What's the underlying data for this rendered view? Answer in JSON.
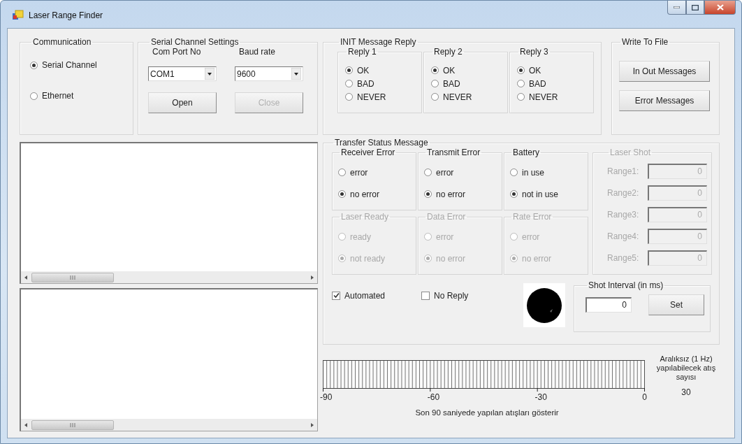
{
  "window": {
    "title": "Laser Range Finder"
  },
  "communication": {
    "title": "Communication",
    "options": [
      {
        "label": "Serial Channel",
        "selected": true
      },
      {
        "label": "Ethernet",
        "selected": false
      }
    ]
  },
  "serial_settings": {
    "title": "Serial Channel Settings",
    "com_port": {
      "label": "Com Port No",
      "value": "COM1"
    },
    "baud_rate": {
      "label": "Baud rate",
      "value": "9600"
    },
    "buttons": [
      {
        "label": "Open",
        "disabled": false
      },
      {
        "label": "Close",
        "disabled": true
      }
    ]
  },
  "init_reply": {
    "title": "INIT Message Reply",
    "groups": [
      {
        "title": "Reply 1",
        "options": [
          {
            "label": "OK",
            "selected": true
          },
          {
            "label": "BAD",
            "selected": false
          },
          {
            "label": "NEVER",
            "selected": false
          }
        ]
      },
      {
        "title": "Reply 2",
        "options": [
          {
            "label": "OK",
            "selected": true
          },
          {
            "label": "BAD",
            "selected": false
          },
          {
            "label": "NEVER",
            "selected": false
          }
        ]
      },
      {
        "title": "Reply 3",
        "options": [
          {
            "label": "OK",
            "selected": true
          },
          {
            "label": "BAD",
            "selected": false
          },
          {
            "label": "NEVER",
            "selected": false
          }
        ]
      }
    ]
  },
  "write_to_file": {
    "title": "Write To File",
    "buttons": [
      "In Out Messages",
      "Error Messages"
    ]
  },
  "transfer_status": {
    "title": "Transfer Status Message",
    "groups": [
      {
        "title": "Receiver Error",
        "disabled": false,
        "options": [
          {
            "label": "error",
            "selected": false
          },
          {
            "label": "no error",
            "selected": true
          }
        ]
      },
      {
        "title": "Transmit Error",
        "disabled": false,
        "options": [
          {
            "label": "error",
            "selected": false
          },
          {
            "label": "no error",
            "selected": true
          }
        ]
      },
      {
        "title": "Battery",
        "disabled": false,
        "options": [
          {
            "label": "in use",
            "selected": false
          },
          {
            "label": "not in use",
            "selected": true
          }
        ]
      },
      {
        "title": "Laser Ready",
        "disabled": true,
        "options": [
          {
            "label": "ready",
            "selected": false
          },
          {
            "label": "not ready",
            "selected": true
          }
        ]
      },
      {
        "title": "Data Error",
        "disabled": true,
        "options": [
          {
            "label": "error",
            "selected": false
          },
          {
            "label": "no error",
            "selected": true
          }
        ]
      },
      {
        "title": "Rate Error",
        "disabled": true,
        "options": [
          {
            "label": "error",
            "selected": false
          },
          {
            "label": "no error",
            "selected": true
          }
        ]
      }
    ],
    "laser_shot": {
      "title": "Laser Shot",
      "disabled": true,
      "ranges": [
        {
          "label": "Range1:",
          "value": "0"
        },
        {
          "label": "Range2:",
          "value": "0"
        },
        {
          "label": "Range3:",
          "value": "0"
        },
        {
          "label": "Range4:",
          "value": "0"
        },
        {
          "label": "Range5:",
          "value": "0"
        }
      ]
    },
    "checkboxes": [
      {
        "label": "Automated",
        "checked": true
      },
      {
        "label": "No Reply",
        "checked": false
      }
    ],
    "shot_interval": {
      "title": "Shot Interval (in ms)",
      "value": "0",
      "button": "Set"
    }
  },
  "shot_history": {
    "ticks": [
      "-90",
      "-60",
      "-30",
      "0"
    ],
    "caption": "Son 90 saniyede yapılan atışları gösterir",
    "count_label": "Aralıksız (1 Hz) yapılabilecek atış sayısı",
    "count": "30"
  }
}
